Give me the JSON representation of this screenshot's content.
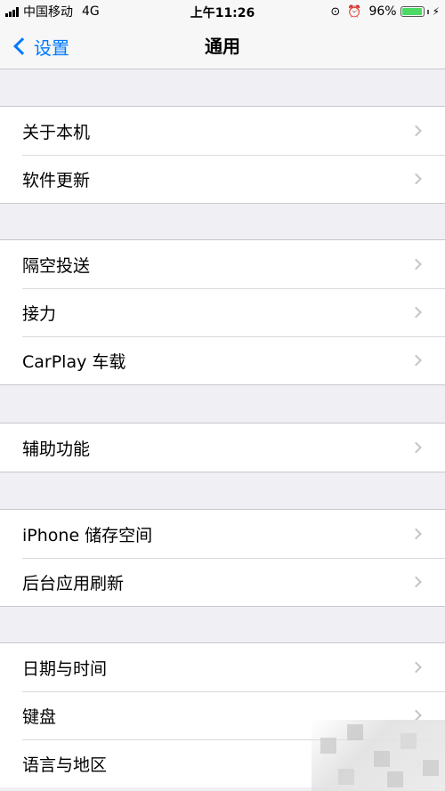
{
  "status_bar": {
    "carrier": "中国移动",
    "network": "4G",
    "time": "上午11:26",
    "battery_percent": "96%",
    "battery_level": 0.96,
    "icons": [
      "signal-icon",
      "orientation-lock-icon",
      "alarm-icon",
      "battery-icon",
      "charging-bolt-icon"
    ]
  },
  "nav": {
    "back_label": "设置",
    "title": "通用"
  },
  "groups": [
    {
      "items": [
        "关于本机",
        "软件更新"
      ]
    },
    {
      "items": [
        "隔空投送",
        "接力",
        "CarPlay 车载"
      ]
    },
    {
      "items": [
        "辅助功能"
      ]
    },
    {
      "items": [
        "iPhone 储存空间",
        "后台应用刷新"
      ]
    },
    {
      "items": [
        "日期与时间",
        "键盘",
        "语言与地区"
      ]
    }
  ],
  "colors": {
    "accent": "#007aff",
    "background": "#efeff4",
    "battery": "#4cd964"
  }
}
